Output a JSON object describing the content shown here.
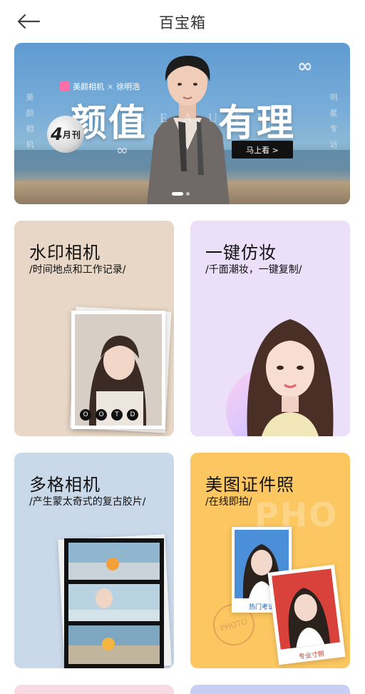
{
  "header": {
    "title": "百宝箱",
    "back_icon": "arrow-left-icon"
  },
  "banner": {
    "brand_app": "美颜相机",
    "brand_cross": "×",
    "brand_star": "徐明浩",
    "headline_left": "颜值",
    "headline_right": "有理",
    "beauty_word": "BEAUTY",
    "beauty_end": "M",
    "issue_month": "4",
    "issue_unit": "月",
    "issue_word": "刊",
    "vertical_left": [
      "美",
      "颜",
      "相",
      "机"
    ],
    "vertical_right": [
      "明",
      "星",
      "专",
      "访"
    ],
    "cta_label": "马上看 >",
    "slide_index": 1,
    "slide_count": 2
  },
  "cards": [
    {
      "title": "水印相机",
      "subtitle": "/时间地点和工作记录/",
      "badge_letters": [
        "O",
        "O",
        "T",
        "D"
      ],
      "color": "#e8d7c6"
    },
    {
      "title": "一键仿妆",
      "subtitle": "/千面潮妆，一键复制/",
      "color": "#ecdffa"
    },
    {
      "title": "多格相机",
      "subtitle": "/产生蒙太奇式的复古胶片/",
      "color": "#cad9ea"
    },
    {
      "title": "美图证件照",
      "subtitle": "/在线即拍/",
      "ghost_text": "PHO",
      "stamp_text": "PHOTO",
      "tag_left": "热门考试",
      "tag_right": "专业寸照",
      "color": "#fcc760"
    },
    {
      "color": "#f9dbe4"
    },
    {
      "color": "#c8cff4"
    }
  ]
}
